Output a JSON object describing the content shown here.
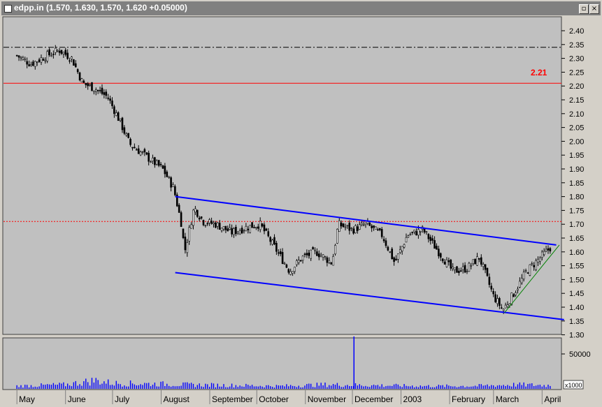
{
  "window": {
    "title": "edpp.in",
    "quote": "(1.570, 1.630, 1.570, 1.620 +0.05000)",
    "icon": "chart-window-icon",
    "buttons": [
      "restore-button",
      "close-button"
    ]
  },
  "price_panel": {
    "line_label": "2.21"
  },
  "volume_panel": {
    "tick_label": "50000",
    "multiplier_label": "x1000"
  },
  "colors": {
    "plot_bg": "#c0c0c0",
    "candle": "#000000",
    "channel": "#0000ff",
    "support_line": "#008000",
    "resistance_line": "#ff0000",
    "volume": "#0000ff"
  },
  "chart_data": [
    {
      "type": "candlestick",
      "title": "",
      "xlabel": "",
      "ylabel": "",
      "ylim": [
        1.3,
        2.43
      ],
      "grid": false,
      "months": [
        "May",
        "June",
        "July",
        "August",
        "September",
        "October",
        "November",
        "December",
        "2003",
        "February",
        "March",
        "April"
      ],
      "y_ticks": [
        "2.40",
        "2.35",
        "2.30",
        "2.25",
        "2.20",
        "2.15",
        "2.10",
        "2.05",
        "2.00",
        "1.95",
        "1.90",
        "1.85",
        "1.80",
        "1.75",
        "1.70",
        "1.65",
        "1.60",
        "1.55",
        "1.50",
        "1.45",
        "1.40",
        "1.35",
        "1.30"
      ],
      "close_path": [
        [
          "2002-05-01",
          2.31
        ],
        [
          "2002-05-10",
          2.28
        ],
        [
          "2002-05-20",
          2.31
        ],
        [
          "2002-05-28",
          2.33
        ],
        [
          "2002-06-05",
          2.3
        ],
        [
          "2002-06-12",
          2.21
        ],
        [
          "2002-06-20",
          2.19
        ],
        [
          "2002-06-28",
          2.16
        ],
        [
          "2002-07-05",
          2.08
        ],
        [
          "2002-07-12",
          1.99
        ],
        [
          "2002-07-19",
          1.96
        ],
        [
          "2002-07-26",
          1.93
        ],
        [
          "2002-08-02",
          1.9
        ],
        [
          "2002-08-09",
          1.83
        ],
        [
          "2002-08-14",
          1.7
        ],
        [
          "2002-08-16",
          1.6
        ],
        [
          "2002-08-22",
          1.76
        ],
        [
          "2002-08-28",
          1.71
        ],
        [
          "2002-09-05",
          1.7
        ],
        [
          "2002-09-15",
          1.67
        ],
        [
          "2002-09-25",
          1.69
        ],
        [
          "2002-10-03",
          1.7
        ],
        [
          "2002-10-12",
          1.62
        ],
        [
          "2002-10-22",
          1.53
        ],
        [
          "2002-10-30",
          1.58
        ],
        [
          "2002-11-08",
          1.6
        ],
        [
          "2002-11-18",
          1.56
        ],
        [
          "2002-11-22",
          1.7
        ],
        [
          "2002-12-01",
          1.68
        ],
        [
          "2002-12-10",
          1.7
        ],
        [
          "2002-12-20",
          1.66
        ],
        [
          "2002-12-28",
          1.56
        ],
        [
          "2003-01-05",
          1.66
        ],
        [
          "2003-01-15",
          1.68
        ],
        [
          "2003-01-25",
          1.6
        ],
        [
          "2003-02-03",
          1.53
        ],
        [
          "2003-02-12",
          1.54
        ],
        [
          "2003-02-20",
          1.58
        ],
        [
          "2003-03-01",
          1.44
        ],
        [
          "2003-03-07",
          1.39
        ],
        [
          "2003-03-14",
          1.45
        ],
        [
          "2003-03-22",
          1.53
        ],
        [
          "2003-03-31",
          1.58
        ],
        [
          "2003-04-07",
          1.62
        ]
      ],
      "last": {
        "open": 1.57,
        "high": 1.63,
        "low": 1.57,
        "close": 1.62,
        "change": 0.05
      },
      "horizontal_lines": [
        {
          "style": "solid",
          "color": "red",
          "value": 2.21
        },
        {
          "style": "dotted",
          "color": "red",
          "value": 1.71
        },
        {
          "style": "dashdot",
          "color": "black",
          "value": 2.34
        }
      ],
      "trend_lines": [
        {
          "name": "upper-channel",
          "color": "blue",
          "from": [
            "2002-08-10",
            1.8
          ],
          "to": [
            "2003-04-10",
            1.625
          ]
        },
        {
          "name": "lower-channel",
          "color": "blue",
          "from": [
            "2002-08-10",
            1.525
          ],
          "to": [
            "2003-04-15",
            1.355
          ]
        },
        {
          "name": "rising-support",
          "color": "green",
          "from": [
            "2003-03-08",
            1.38
          ],
          "to": [
            "2003-04-12",
            1.625
          ]
        }
      ]
    },
    {
      "type": "bar",
      "title": "",
      "unit_multiplier": 1000,
      "ylim": [
        0,
        80000
      ],
      "spike": {
        "date": "2002-12-02",
        "value": 75000
      },
      "volume_path": [
        [
          "2002-05-01",
          4000
        ],
        [
          "2002-06-01",
          6000
        ],
        [
          "2002-06-20",
          12000
        ],
        [
          "2002-07-01",
          8000
        ],
        [
          "2002-08-01",
          7000
        ],
        [
          "2002-08-15",
          6000
        ],
        [
          "2002-09-15",
          5000
        ],
        [
          "2002-10-15",
          4000
        ],
        [
          "2002-11-15",
          6000
        ],
        [
          "2002-12-15",
          5000
        ],
        [
          "2003-01-15",
          4000
        ],
        [
          "2003-02-15",
          4000
        ],
        [
          "2003-03-15",
          6000
        ],
        [
          "2003-04-07",
          5000
        ]
      ]
    }
  ]
}
